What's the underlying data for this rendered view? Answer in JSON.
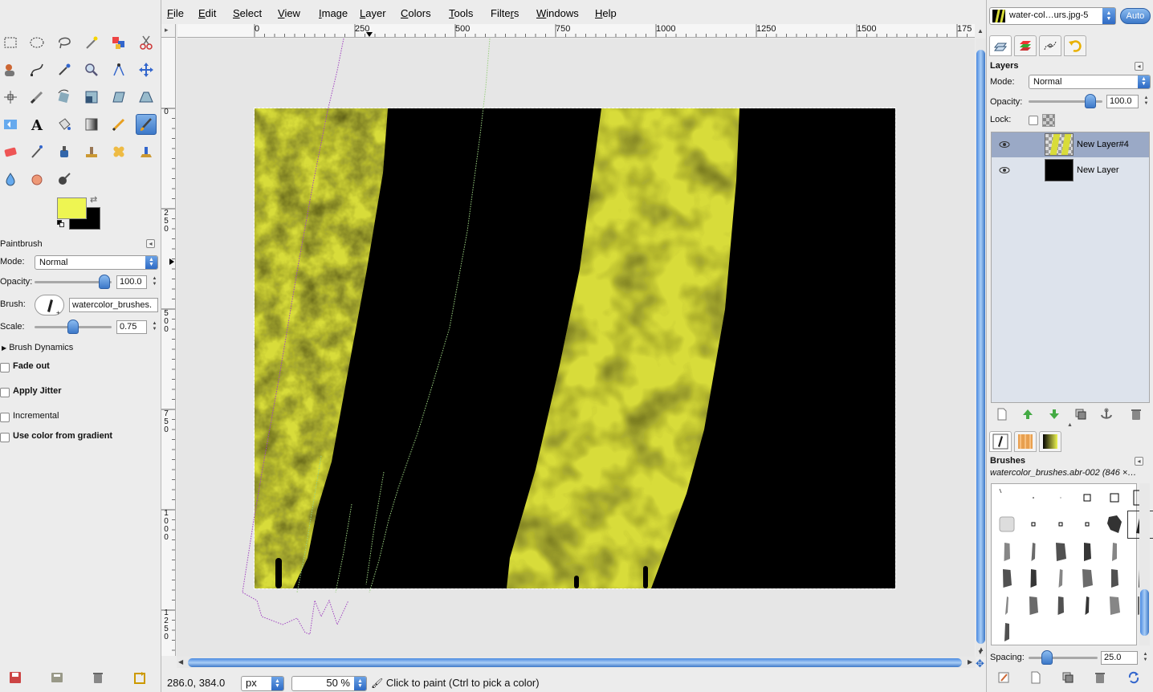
{
  "menubar": {
    "items": [
      "File",
      "Edit",
      "Select",
      "View",
      "Image",
      "Layer",
      "Colors",
      "Tools",
      "Filters",
      "Windows",
      "Help"
    ],
    "mnemonics": [
      "F",
      "E",
      "S",
      "V",
      "I",
      "L",
      "C",
      "T",
      "r",
      "W",
      "H"
    ]
  },
  "tool_options": {
    "title": "Paintbrush",
    "mode_label": "Mode:",
    "mode_value": "Normal",
    "opacity_label": "Opacity:",
    "opacity_value": "100.0",
    "opacity_fraction": 1.0,
    "brush_label": "Brush:",
    "brush_value": "watercolor_brushes.",
    "scale_label": "Scale:",
    "scale_value": "0.75",
    "scale_fraction": 0.5,
    "brush_dynamics_label": "Brush Dynamics",
    "checkboxes": [
      {
        "label": "Fade out",
        "checked": false
      },
      {
        "label": "Apply Jitter",
        "checked": false
      },
      {
        "label": "Incremental",
        "checked": false
      },
      {
        "label": "Use color from gradient",
        "checked": false
      }
    ],
    "fg_color": "#eef552",
    "bg_color": "#000000"
  },
  "rulers": {
    "horizontal": [
      "0",
      "250",
      "500",
      "750",
      "1000",
      "1250",
      "1500",
      "175"
    ],
    "vertical": [
      "0",
      "250",
      "500",
      "750",
      "1000",
      "1250"
    ]
  },
  "status": {
    "coords": "286.0, 384.0",
    "unit": "px",
    "zoom": "50 %",
    "message": "Click to paint (Ctrl to pick a color)"
  },
  "dock": {
    "image_selector": "water-col…urs.jpg-5",
    "auto_label": "Auto",
    "layers": {
      "title": "Layers",
      "mode_label": "Mode:",
      "mode_value": "Normal",
      "opacity_label": "Opacity:",
      "opacity_value": "100.0",
      "lock_label": "Lock:",
      "items": [
        {
          "name": "New Layer#4",
          "selected": true
        },
        {
          "name": "New Layer",
          "selected": false
        }
      ]
    },
    "brushes": {
      "title": "Brushes",
      "current": "watercolor_brushes.abr-002 (846 ×…",
      "spacing_label": "Spacing:",
      "spacing_value": "25.0"
    }
  },
  "colors": {
    "accent": "#3c78c8",
    "paint": "#d8dc3a"
  }
}
